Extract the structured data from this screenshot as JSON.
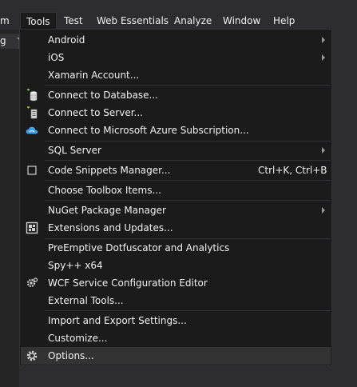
{
  "menubar": {
    "items": [
      {
        "label": "m"
      },
      {
        "label": "Tools"
      },
      {
        "label": "Test"
      },
      {
        "label": "Web Essentials"
      },
      {
        "label": "Analyze"
      },
      {
        "label": "Window"
      },
      {
        "label": "Help"
      }
    ],
    "active_item": "Tools"
  },
  "left_panel": {
    "field_text": "g"
  },
  "tools_menu": {
    "items": [
      {
        "label": "Android",
        "has_submenu": true
      },
      {
        "label": "iOS",
        "has_submenu": true
      },
      {
        "label": "Xamarin Account..."
      },
      {
        "label": "Connect to Database...",
        "icon": "connect-database-icon"
      },
      {
        "label": "Connect to Server...",
        "icon": "connect-server-icon"
      },
      {
        "label": "Connect to Microsoft Azure Subscription...",
        "icon": "azure-cloud-icon"
      },
      {
        "label": "SQL Server",
        "has_submenu": true
      },
      {
        "label": "Code Snippets Manager...",
        "shortcut": "Ctrl+K, Ctrl+B",
        "icon": "snippet-icon"
      },
      {
        "label": "Choose Toolbox Items..."
      },
      {
        "label": "NuGet Package Manager",
        "has_submenu": true
      },
      {
        "label": "Extensions and Updates...",
        "icon": "extensions-icon"
      },
      {
        "label": "PreEmptive Dotfuscator and Analytics"
      },
      {
        "label": "Spy++ x64"
      },
      {
        "label": "WCF Service Configuration Editor",
        "icon": "wcf-gear-icon"
      },
      {
        "label": "External Tools..."
      },
      {
        "label": "Import and Export Settings..."
      },
      {
        "label": "Customize..."
      },
      {
        "label": "Options...",
        "icon": "options-gear-icon",
        "highlighted": true
      }
    ]
  },
  "colors": {
    "menu_background": "#1b1b1c",
    "chrome_background": "#2d2d30",
    "text": "#f1f1f1",
    "highlight": "#333334",
    "azure_accent": "#3aa0f3"
  }
}
